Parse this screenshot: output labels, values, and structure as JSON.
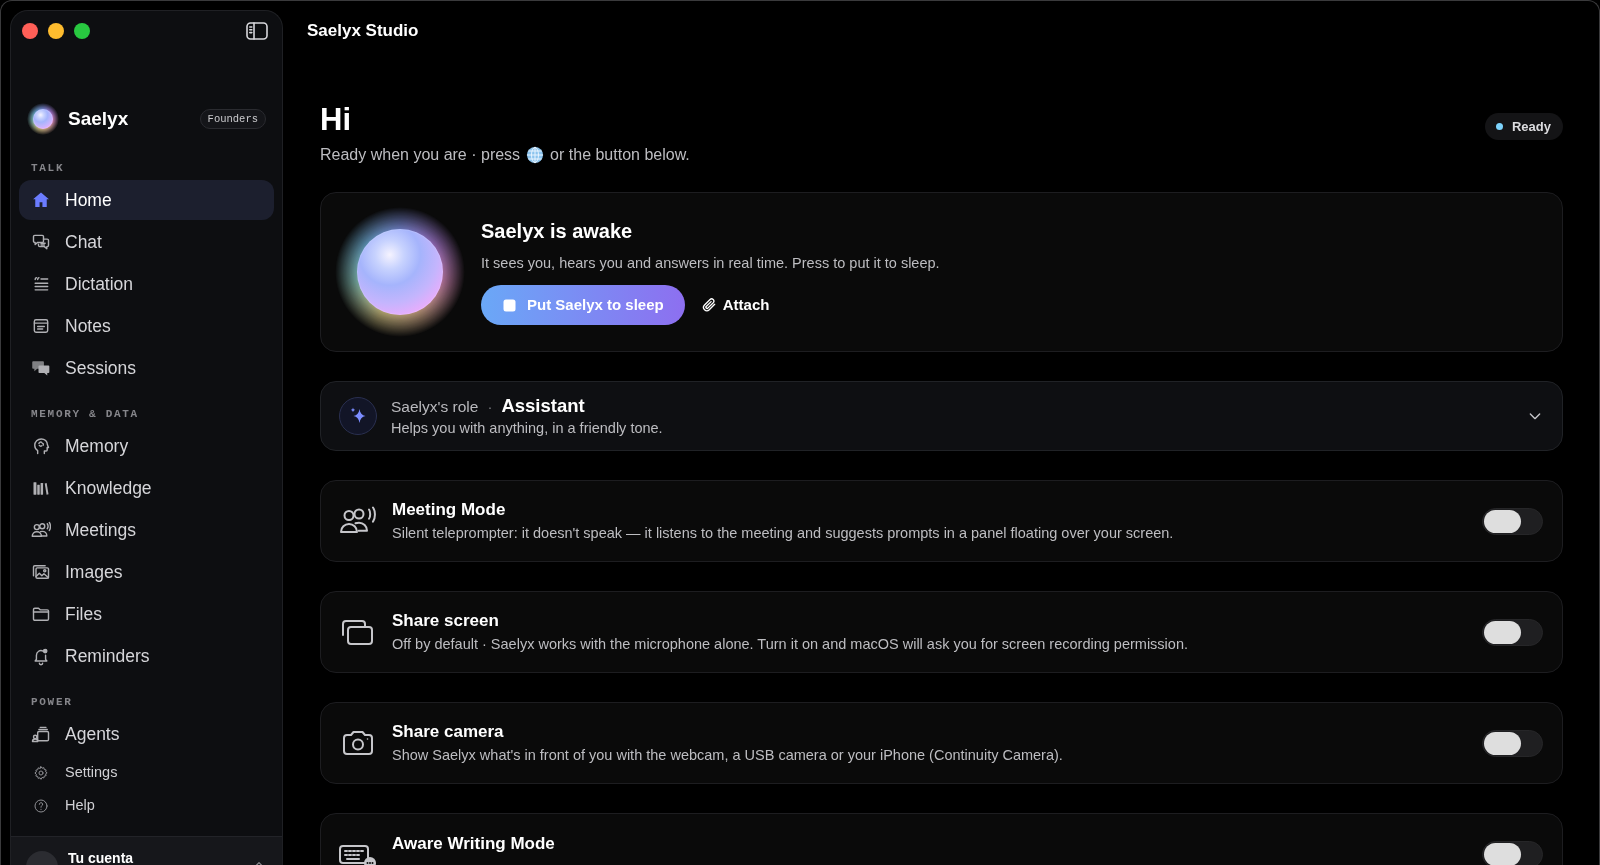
{
  "window": {
    "title": "Saelyx Studio"
  },
  "sidebar": {
    "brand": "Saelyx",
    "badge": "Founders",
    "sections": [
      {
        "label": "TALK",
        "items": [
          {
            "label": "Home",
            "selected": true
          },
          {
            "label": "Chat",
            "selected": false
          },
          {
            "label": "Dictation",
            "selected": false
          },
          {
            "label": "Notes",
            "selected": false
          },
          {
            "label": "Sessions",
            "selected": false
          }
        ]
      },
      {
        "label": "MEMORY & DATA",
        "items": [
          {
            "label": "Memory",
            "selected": false
          },
          {
            "label": "Knowledge",
            "selected": false
          },
          {
            "label": "Meetings",
            "selected": false
          },
          {
            "label": "Images",
            "selected": false
          },
          {
            "label": "Files",
            "selected": false
          },
          {
            "label": "Reminders",
            "selected": false
          }
        ]
      },
      {
        "label": "POWER",
        "items": [
          {
            "label": "Agents",
            "selected": false
          }
        ]
      }
    ],
    "utility_links": [
      "Settings",
      "Help"
    ],
    "account": {
      "label": "Tu cuenta"
    }
  },
  "header": {
    "greeting": "Hi",
    "subtitle_before_icon": "Ready when you are · press",
    "subtitle_after_icon": "or the button below.",
    "status": "Ready"
  },
  "hero": {
    "title": "Saelyx is awake",
    "description": "It sees you, hears you and answers in real time. Press to put it to sleep.",
    "primary_button": "Put Saelyx to sleep",
    "secondary_button": "Attach"
  },
  "role": {
    "label": "Saelyx's role",
    "separator": "·",
    "value": "Assistant",
    "description": "Helps you with anything, in a friendly tone.",
    "expanded": false
  },
  "features": [
    {
      "title": "Meeting Mode",
      "description": "Silent teleprompter: it doesn't speak — it listens to the meeting and suggests prompts in a panel floating over your screen.",
      "on": false
    },
    {
      "title": "Share screen",
      "description": "Off by default · Saelyx works with the microphone alone. Turn it on and macOS will ask you for screen recording permission.",
      "on": false
    },
    {
      "title": "Share camera",
      "description": "Show Saelyx what's in front of you with the webcam, a USB camera or your iPhone (Continuity Camera).",
      "on": false
    },
    {
      "title": "Aware Writing Mode",
      "on": false
    }
  ]
}
